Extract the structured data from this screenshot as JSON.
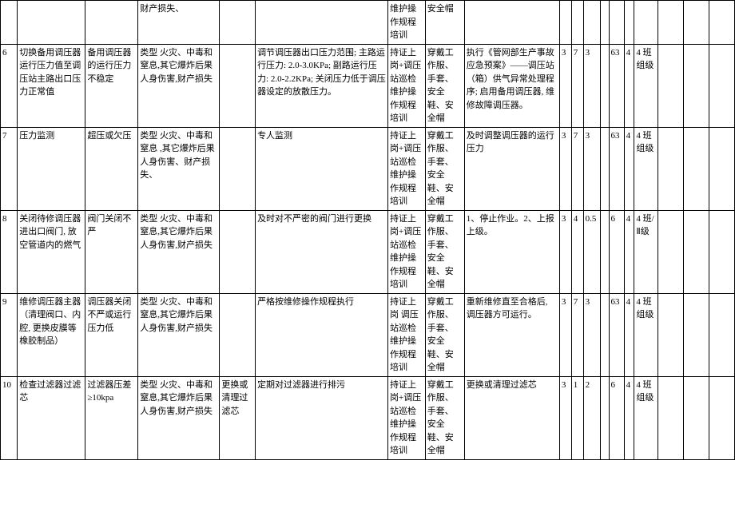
{
  "rows": [
    {
      "c0": "",
      "c1": "",
      "c2": "",
      "c3": "财产损失、",
      "c4": "",
      "c5": "",
      "c6": "维护操作规程培训",
      "c7": "安全帽",
      "c8": "",
      "c9": "",
      "c10": "",
      "c11": "",
      "c12": "",
      "c13": "",
      "c14": "",
      "c15": "",
      "c16": "",
      "c17": "",
      "c18": ""
    },
    {
      "c0": "6",
      "c1": "切换备用调压器运行压力值至调压站主路出口压力正常值",
      "c2": "备用调压器的运行压力不稳定",
      "c3": "类型 火灾、中毒和窒息,其它爆炸后果 人身伤害,财产损失",
      "c4": "",
      "c5": "调节调压器出口压力范围; 主路运行压力: 2.0-3.0KPa; 副路运行压力: 2.0-2.2KPa; 关闭压力低于调压器设定的放散压力。",
      "c6": "持证上岗+调压站巡检维护操作规程培训",
      "c7": "穿戴工作服、手套、安全鞋、安全帽",
      "c8": "执行《管网部生产事故应急预案》——调压站（箱）供气异常处理程序; 启用备用调压器, 维修故障调压器。",
      "c9": "3",
      "c10": "7",
      "c11": "3",
      "c12": "",
      "c13": "63",
      "c14": "4",
      "c15": "4 班组级",
      "c16": "",
      "c17": "",
      "c18": ""
    },
    {
      "c0": "7",
      "c1": "压力监测",
      "c2": "超压或欠压",
      "c3": "类型 火灾、中毒和窒息 ,其它爆炸后果 人身伤害、财产损失、",
      "c4": "",
      "c5": "专人监测",
      "c6": "持证上岗+调压站巡检维护操作规程培训",
      "c7": "穿戴工作服、手套、安全鞋、安全帽",
      "c8": "及时调整调压器的运行压力",
      "c9": "3",
      "c10": "7",
      "c11": "3",
      "c12": "",
      "c13": "63",
      "c14": "4",
      "c15": "4 班组级",
      "c16": "",
      "c17": "",
      "c18": ""
    },
    {
      "c0": "8",
      "c1": "关闭待修调压器进出口阀门, 放空管道内的燃气",
      "c2": "阀门关闭不严",
      "c3": "类型 火灾、中毒和窒息,其它爆炸后果 人身伤害,财产损失",
      "c4": "",
      "c5": "及时对不严密的阀门进行更换",
      "c6": "持证上岗+调压站巡检维护操作规程培训",
      "c7": "穿戴工作服、手套、安全鞋、安全帽",
      "c8": "1、停止作业。2、上报上级。",
      "c9": "3",
      "c10": "4",
      "c11": "0.5",
      "c12": "",
      "c13": "6",
      "c14": "4",
      "c15": "4 班/Ⅱ级",
      "c16": "",
      "c17": "",
      "c18": ""
    },
    {
      "c0": "9",
      "c1": "维修调压器主器（清理阀口、内腔, 更换皮膜等橡胶制品）",
      "c2": "调压器关闭不严或运行压力低",
      "c3": "类型 火灾、中毒和窒息,其它爆炸后果 人身伤害,财产损失",
      "c4": "",
      "c5": "严格按维修操作规程执行",
      "c6": "持证上岗 调压站巡检维护操作规程培训",
      "c7": "穿戴工作服、手套、安全鞋、安全帽",
      "c8": "重新维修直至合格后, 调压器方可运行。",
      "c9": "3",
      "c10": "7",
      "c11": "3",
      "c12": "",
      "c13": "63",
      "c14": "4",
      "c15": "4 班组级",
      "c16": "",
      "c17": "",
      "c18": ""
    },
    {
      "c0": "10",
      "c1": "检查过滤器过滤芯",
      "c2": "过滤器压差≥10kpa",
      "c3": "类型 火灾、中毒和窒息,其它爆炸后果 人身伤害,财产损失",
      "c4": "更换或清理过滤芯",
      "c5": "定期对过滤器进行排污",
      "c6": "持证上岗+调压站巡检维护操作规程培训",
      "c7": "穿戴工作服、手套、安全鞋、安全帽",
      "c8": "更换或清理过滤芯",
      "c9": "3",
      "c10": "1",
      "c11": "2",
      "c12": "",
      "c13": "6",
      "c14": "4",
      "c15": "4 班组级",
      "c16": "",
      "c17": "",
      "c18": ""
    }
  ]
}
